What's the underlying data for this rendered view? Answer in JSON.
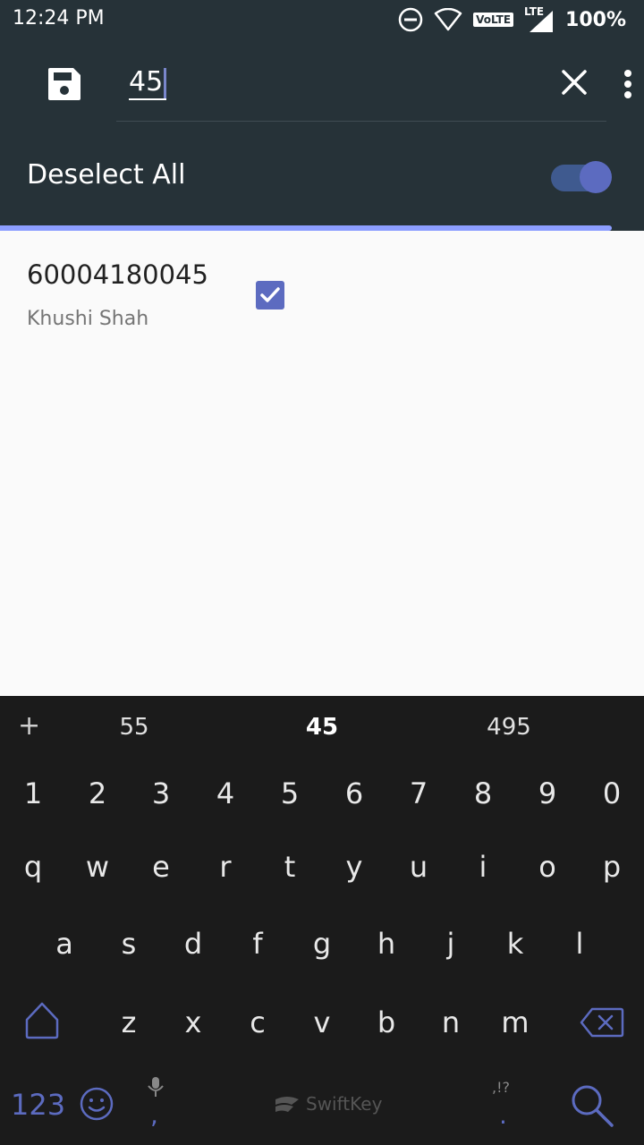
{
  "status_bar": {
    "time": "12:24 PM",
    "volte": "VoLTE",
    "lte": "LTE",
    "battery": "100%"
  },
  "toolbar": {
    "search_value": "45",
    "deselect_label": "Deselect All",
    "toggle_on": true
  },
  "list": {
    "items": [
      {
        "number": "60004180045",
        "name": "Khushi Shah",
        "checked": true
      }
    ]
  },
  "keyboard": {
    "suggestions": [
      "55",
      "45",
      "495"
    ],
    "number_row": [
      "1",
      "2",
      "3",
      "4",
      "5",
      "6",
      "7",
      "8",
      "9",
      "0"
    ],
    "row1": [
      "q",
      "w",
      "e",
      "r",
      "t",
      "y",
      "u",
      "i",
      "o",
      "p"
    ],
    "row2": [
      "a",
      "s",
      "d",
      "f",
      "g",
      "h",
      "j",
      "k",
      "l"
    ],
    "row3": [
      "z",
      "x",
      "c",
      "v",
      "b",
      "n",
      "m"
    ],
    "num_toggle": "123",
    "comma": ",",
    "brand": "SwiftKey",
    "punct_hint": ",!?",
    "period": "."
  },
  "colors": {
    "toolbar_bg": "#263238",
    "accent": "#5c6bc0",
    "progress": "#8c9eff",
    "keyboard_bg": "#1b1b1b"
  }
}
